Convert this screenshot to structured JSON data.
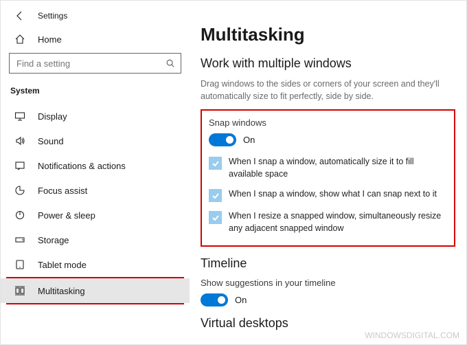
{
  "header": {
    "title": "Settings"
  },
  "sidebar": {
    "home": "Home",
    "search_placeholder": "Find a setting",
    "category": "System",
    "items": [
      {
        "label": "Display"
      },
      {
        "label": "Sound"
      },
      {
        "label": "Notifications & actions"
      },
      {
        "label": "Focus assist"
      },
      {
        "label": "Power & sleep"
      },
      {
        "label": "Storage"
      },
      {
        "label": "Tablet mode"
      },
      {
        "label": "Multitasking"
      }
    ]
  },
  "main": {
    "title": "Multitasking",
    "section1": {
      "heading": "Work with multiple windows",
      "desc": "Drag windows to the sides or corners of your screen and they'll automatically size to fit perfectly, side by side.",
      "snap_label": "Snap windows",
      "snap_toggle_state": "On",
      "checks": [
        "When I snap a window, automatically size it to fill available space",
        "When I snap a window, show what I can snap next to it",
        "When I resize a snapped window, simultaneously resize any adjacent snapped window"
      ]
    },
    "section2": {
      "heading": "Timeline",
      "sub_label": "Show suggestions in your timeline",
      "toggle_state": "On"
    },
    "section3": {
      "heading": "Virtual desktops"
    }
  },
  "watermark": "WindowsDigital.com"
}
